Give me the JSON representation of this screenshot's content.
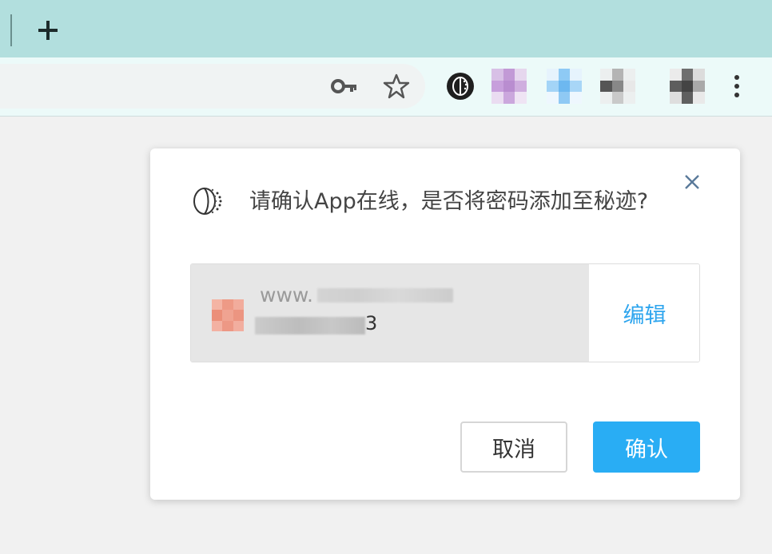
{
  "browser": {
    "new_tab_label": "+",
    "icons": {
      "new_tab": "plus-icon",
      "password_key": "key-icon",
      "bookmark": "star-icon",
      "extension": "mijing-icon",
      "menu": "more-vertical-icon"
    }
  },
  "dialog": {
    "title": "请确认App在线，是否将密码添加至秘迹?",
    "entry": {
      "url_prefix": "www.",
      "username_suffix": "3",
      "edit_label": "编辑"
    },
    "cancel_label": "取消",
    "confirm_label": "确认"
  },
  "colors": {
    "tabstrip": "#b2dfde",
    "toolbar": "#ecfaf9",
    "accent": "#29adf4",
    "link": "#2ea5ee"
  }
}
